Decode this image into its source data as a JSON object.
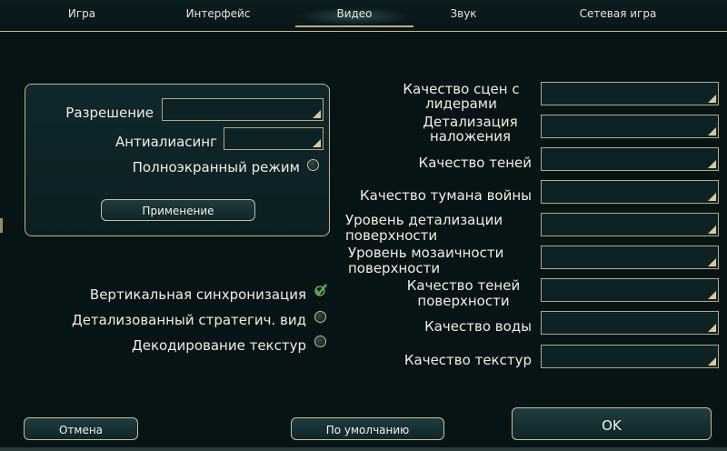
{
  "tabs": [
    {
      "label": "Игра"
    },
    {
      "label": "Интерфейс"
    },
    {
      "label": "Видео",
      "active": true
    },
    {
      "label": "Звук"
    },
    {
      "label": "Сетевая игра"
    }
  ],
  "display": {
    "resolution_label": "Разрешение",
    "resolution_value": "",
    "antialiasing_label": "Антиалиасинг",
    "antialiasing_value": "",
    "fullscreen_label": "Полноэкранный режим",
    "fullscreen_checked": false,
    "apply_label": "Применение"
  },
  "options": {
    "vsync_label": "Вертикальная синхронизация",
    "vsync_checked": true,
    "strategic_view_label": "Детализованный стратегич. вид",
    "strategic_view_checked": false,
    "texture_decoding_label": "Декодирование текстур",
    "texture_decoding_checked": false
  },
  "quality": [
    {
      "label": "Качество сцен с лидерами",
      "value": ""
    },
    {
      "label": "Детализация наложения",
      "value": ""
    },
    {
      "label": "Качество теней",
      "value": ""
    },
    {
      "label": "Качество тумана войны",
      "value": ""
    },
    {
      "label": "Уровень детализации поверхности",
      "value": ""
    },
    {
      "label": "Уровень мозаичности поверхности",
      "value": ""
    },
    {
      "label": "Качество теней поверхности",
      "value": ""
    },
    {
      "label": "Качество воды",
      "value": ""
    },
    {
      "label": "Качество текстур",
      "value": ""
    }
  ],
  "footer": {
    "cancel_label": "Отмена",
    "defaults_label": "По умолчанию",
    "ok_label": "OK"
  },
  "colors": {
    "background": "#071416",
    "border_gold": "#c3b58a",
    "check_green": "#3fbf3a"
  }
}
